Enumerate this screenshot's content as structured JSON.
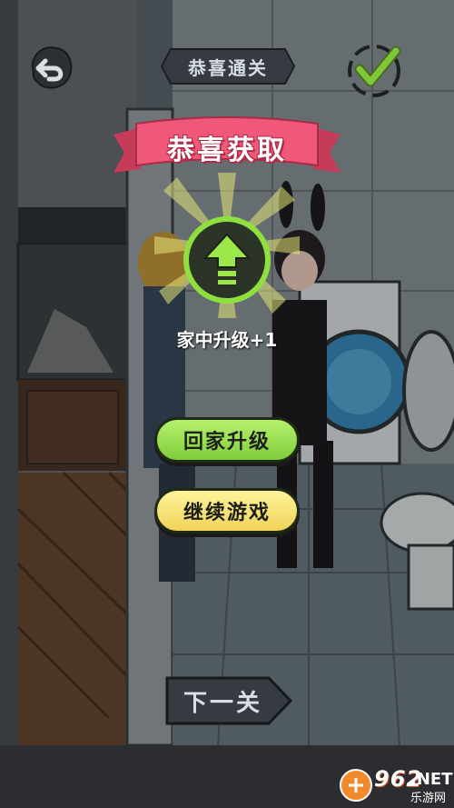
{
  "header": {
    "back_icon": "undo-arrow-icon",
    "title": "恭喜通关",
    "done_icon": "checkmark-icon"
  },
  "popup": {
    "banner": "恭喜获取",
    "reward_icon": "upgrade-arrow-icon",
    "reward_label": "家中升级+1",
    "buttons": {
      "home_upgrade": "回家升级",
      "continue_game": "继续游戏"
    }
  },
  "footer": {
    "next_level": "下一关"
  },
  "watermark": {
    "number": "962",
    "net": ".NET",
    "site": "乐游网"
  },
  "colors": {
    "accent_green": "#8fe03f",
    "banner_pink": "#f0587a",
    "button_green": "#9fe055",
    "button_yellow": "#f7e27a"
  }
}
